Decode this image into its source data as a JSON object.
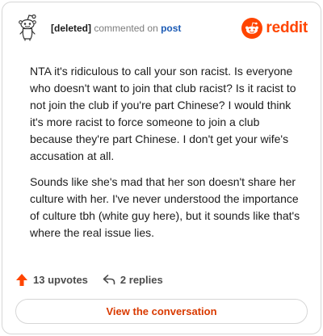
{
  "header": {
    "username": "[deleted]",
    "action_text": "commented on",
    "post_link": "post",
    "brand_name": "reddit",
    "brand_color": "#ff4500"
  },
  "comment": {
    "paragraphs": [
      "NTA it's ridiculous to call your son racist. Is everyone who doesn't want to join that club racist? Is it racist to not join the club if you're part Chinese? I would think it's more racist to force someone to join a club because they're part Chinese. I don't get your wife's accusation at all.",
      "Sounds like she's mad that her son doesn't share her culture with her. I've never understood the importance of culture tbh (white guy here), but it sounds like that's where the real issue lies."
    ]
  },
  "actions": {
    "upvotes_label": "13 upvotes",
    "upvote_icon": "upvote-arrow-icon",
    "replies_label": "2 replies",
    "reply_icon": "reply-arrow-icon"
  },
  "footer": {
    "view_button_label": "View the conversation",
    "accent_color": "#d93a00"
  }
}
